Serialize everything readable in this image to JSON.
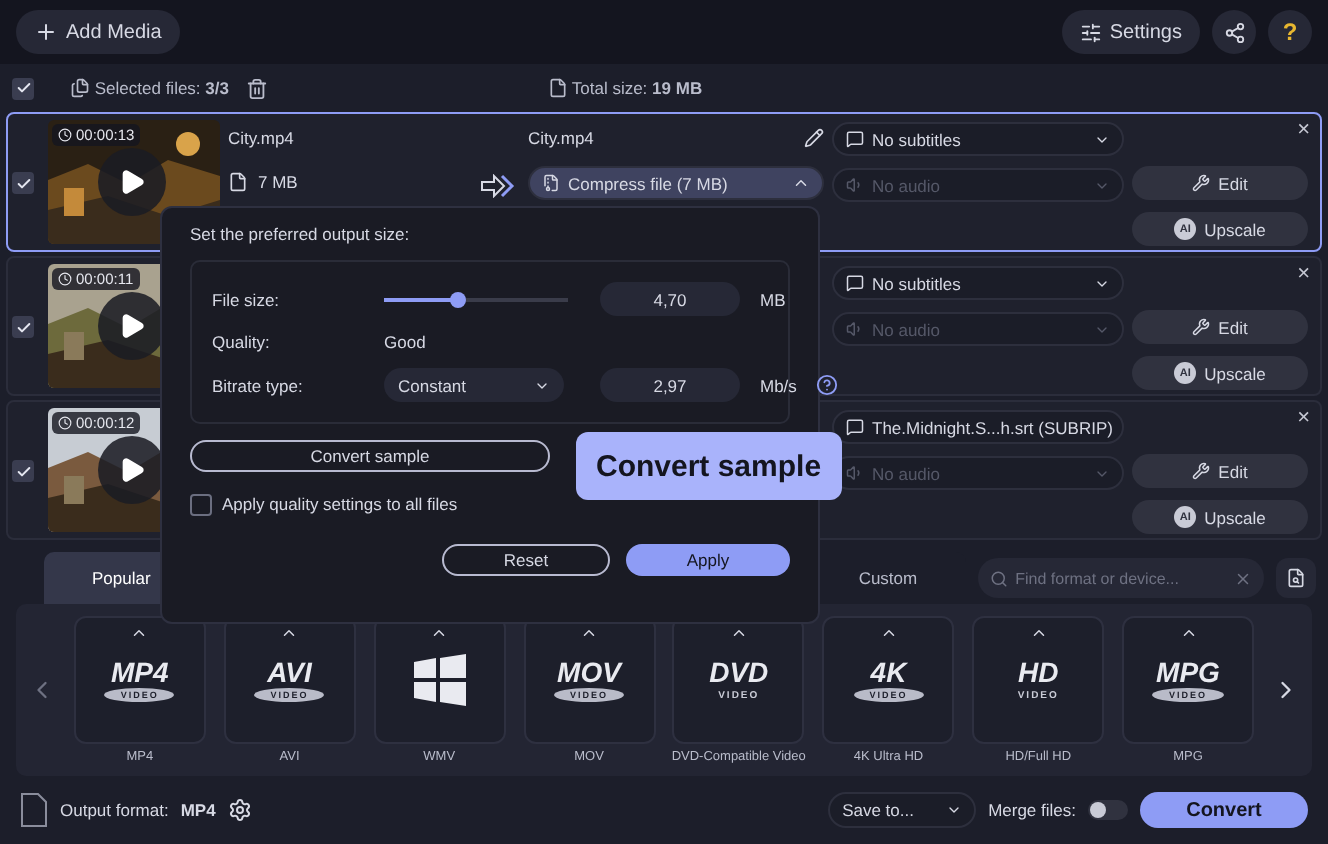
{
  "toolbar": {
    "add_media": "Add Media",
    "settings": "Settings",
    "help": "?"
  },
  "selection_bar": {
    "checked": true,
    "selected_label": "Selected files:",
    "selected_value": "3/3",
    "total_label": "Total size:",
    "total_value": "19 MB"
  },
  "files": [
    {
      "selected": true,
      "checked": true,
      "duration": "00:00:13",
      "name": "City.mp4",
      "size": "7 MB",
      "output_name": "City.mp4",
      "compress": "Compress file (7 MB)",
      "subtitles": {
        "label": "No subtitles",
        "disabled": false
      },
      "audio": {
        "label": "No audio",
        "disabled": true
      },
      "edit": "Edit",
      "upscale": "Upscale",
      "upscale_badge": "AI",
      "close": "×"
    },
    {
      "selected": false,
      "checked": true,
      "duration": "00:00:11",
      "subtitles": {
        "label": "No subtitles",
        "disabled": false
      },
      "audio": {
        "label": "No audio",
        "disabled": true
      },
      "edit": "Edit",
      "upscale": "Upscale",
      "upscale_badge": "AI",
      "close": "×"
    },
    {
      "selected": false,
      "checked": true,
      "duration": "00:00:12",
      "subtitles": {
        "label": "The.Midnight.S...h.srt (SUBRIP)",
        "disabled": false
      },
      "audio": {
        "label": "No audio",
        "disabled": true
      },
      "edit": "Edit",
      "upscale": "Upscale",
      "upscale_badge": "AI",
      "close": "×"
    }
  ],
  "compress_popup": {
    "title": "Set the preferred output size:",
    "file_size_label": "File size:",
    "file_size": {
      "level": 0.4
    },
    "file_size_value": "4,70",
    "file_size_unit": "MB",
    "quality_label": "Quality:",
    "quality_value": "Good",
    "bitrate_label": "Bitrate type:",
    "bitrate_type": "Constant",
    "bitrate_value": "2,97",
    "bitrate_unit": "Mb/s",
    "convert_sample": "Convert sample",
    "apply_all": {
      "label": "Apply quality settings to all files",
      "checked": false
    },
    "reset": "Reset",
    "apply": "Apply"
  },
  "callout": "Convert sample",
  "format_tabs": [
    {
      "label": "Popular",
      "selected": true
    },
    {
      "label": "Custom",
      "selected": false
    }
  ],
  "format_search": {
    "placeholder": "Find format or device..."
  },
  "formats": [
    {
      "logo": "MP4",
      "badge": "VIDEO",
      "label": "MP4",
      "kind": "text"
    },
    {
      "logo": "AVI",
      "badge": "VIDEO",
      "label": "AVI",
      "kind": "text"
    },
    {
      "label": "WMV",
      "kind": "windows"
    },
    {
      "logo": "MOV",
      "badge": "VIDEO",
      "label": "MOV",
      "kind": "text"
    },
    {
      "logo": "DVD",
      "badge": "VIDEO",
      "label": "DVD-Compatible Video",
      "kind": "disc"
    },
    {
      "logo": "4K",
      "badge": "VIDEO",
      "label": "4K Ultra HD",
      "kind": "text"
    },
    {
      "logo": "HD",
      "badge": "VIDEO",
      "label": "HD/Full HD",
      "kind": "disc"
    },
    {
      "logo": "MPG",
      "badge": "VIDEO",
      "label": "MPG",
      "kind": "text"
    }
  ],
  "bottom_bar": {
    "output_label": "Output format:",
    "output_value": "MP4",
    "save_to": "Save to...",
    "merge_label": "Merge files:",
    "merge_on": false,
    "convert": "Convert"
  }
}
